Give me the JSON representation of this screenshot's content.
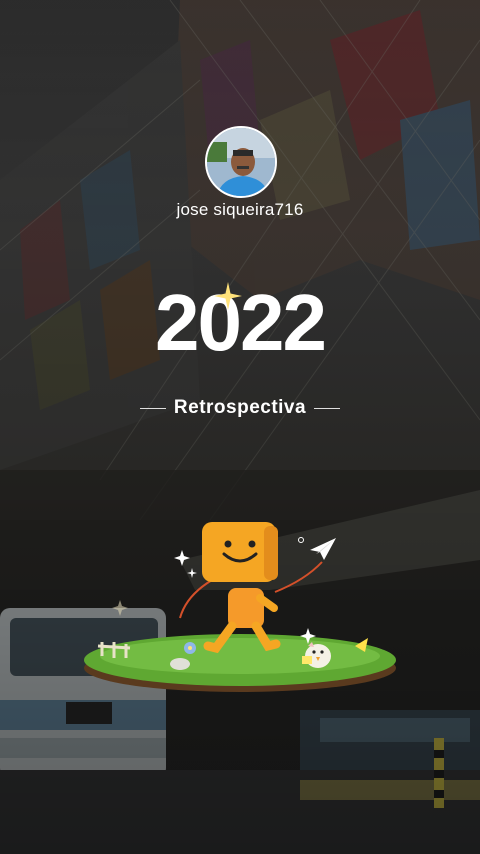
{
  "profile": {
    "username": "jose siqueira716"
  },
  "headline": {
    "year": "2022",
    "subtitle": "Retrospectiva"
  },
  "icons": {
    "avatar": "user-avatar",
    "sparkle": "sparkle-icon",
    "mascot": "box-head-mascot",
    "paper_plane": "paper-plane-icon"
  },
  "colors": {
    "text": "#ffffff",
    "mascot": "#f5a623",
    "grass": "#5fa832"
  }
}
